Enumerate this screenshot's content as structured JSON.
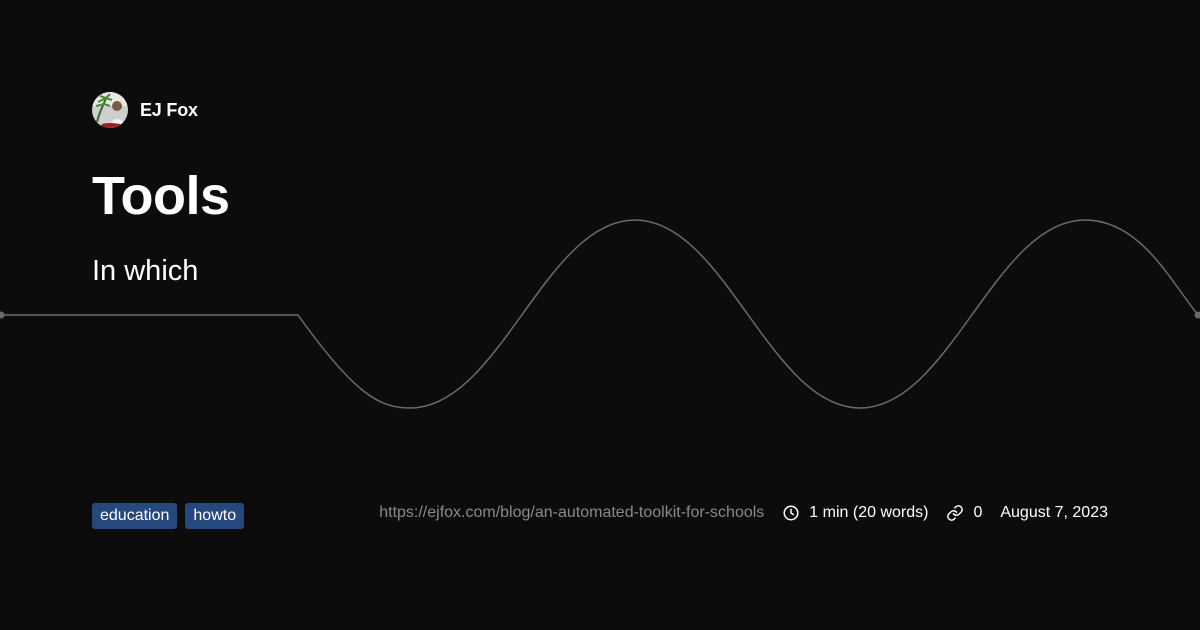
{
  "author": {
    "name": "EJ Fox",
    "avatar_icon": "avatar"
  },
  "post": {
    "title": "Tools",
    "subtitle": "In which"
  },
  "tags": [
    "education",
    "howto"
  ],
  "meta": {
    "url": "https://ejfox.com/blog/an-automated-toolkit-for-schools",
    "read_time": "1 min (20 words)",
    "read_time_icon": "clock-icon",
    "link_count": "0",
    "link_icon": "link-icon",
    "date": "August 7, 2023"
  },
  "colors": {
    "background": "#0c0c0c",
    "text": "#ffffff",
    "muted": "#8a8a8a",
    "tag_bg": "#26487e",
    "wave": "#6b6b6b"
  }
}
